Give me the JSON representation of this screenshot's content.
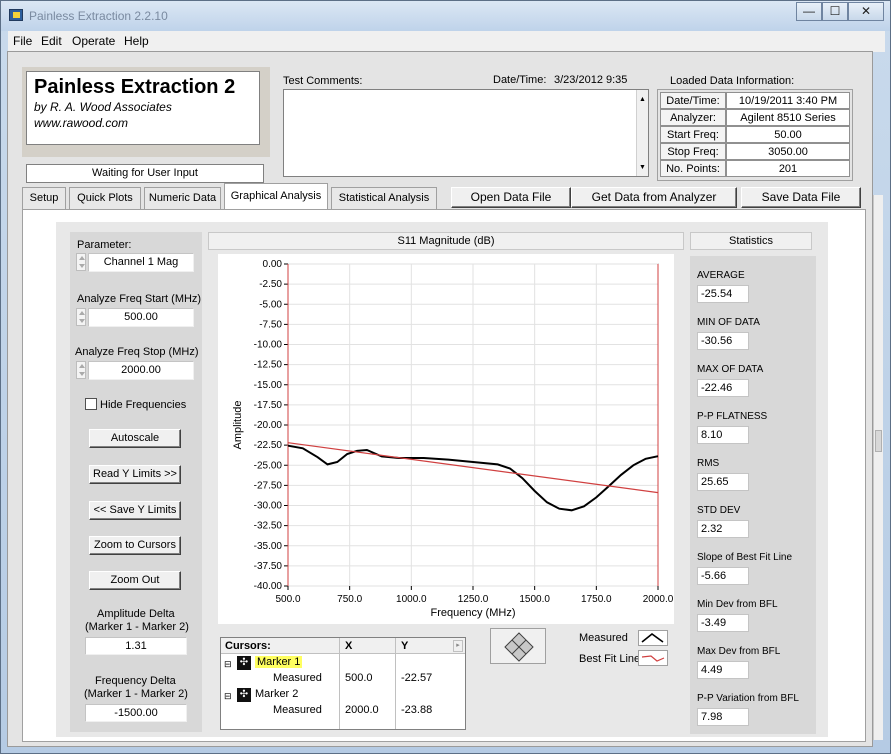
{
  "window": {
    "title": "Painless Extraction 2.2.10",
    "minimize": "—",
    "maximize": "☐",
    "close": "✕"
  },
  "menu": [
    "File",
    "Edit",
    "Operate",
    "Help"
  ],
  "brand": {
    "name": "Painless Extraction 2",
    "by": "by R. A. Wood Associates",
    "url": "www.rawood.com"
  },
  "status": "Waiting for User Input",
  "comments": {
    "label": "Test Comments:",
    "datetime_label": "Date/Time:",
    "datetime_value": "3/23/2012  9:35"
  },
  "loaded": {
    "title": "Loaded Data Information:",
    "rows": [
      {
        "k": "Date/Time:",
        "v": "10/19/2011 3:40 PM"
      },
      {
        "k": "Analyzer:",
        "v": "Agilent 8510 Series"
      },
      {
        "k": "Start Freq:",
        "v": "50.00"
      },
      {
        "k": "Stop Freq:",
        "v": "3050.00"
      },
      {
        "k": "No. Points:",
        "v": "201"
      }
    ]
  },
  "tabs": [
    "Setup",
    "Quick Plots",
    "Numeric Data",
    "Graphical Analysis",
    "Statistical Analysis"
  ],
  "active_tab": "Graphical Analysis",
  "actions": {
    "open": "Open Data File",
    "get": "Get Data from Analyzer",
    "save": "Save Data File"
  },
  "left": {
    "parameter_label": "Parameter:",
    "parameter_value": "Channel 1 Mag",
    "start_label": "Analyze Freq Start (MHz)",
    "start_value": "500.00",
    "stop_label": "Analyze Freq Stop (MHz)",
    "stop_value": "2000.00",
    "hide_freq": "Hide Frequencies",
    "autoscale": "Autoscale",
    "read_y": "Read Y Limits >>",
    "save_y": "<< Save Y Limits",
    "zoom_cursors": "Zoom to Cursors",
    "zoom_out": "Zoom Out",
    "amp_delta_label1": "Amplitude Delta",
    "amp_delta_label2": "(Marker 1 - Marker 2)",
    "amp_delta_value": "1.31",
    "freq_delta_label1": "Frequency Delta",
    "freq_delta_label2": "(Marker 1 - Marker 2)",
    "freq_delta_value": "-1500.00"
  },
  "chart_data": {
    "type": "line",
    "title": "S11 Magnitude (dB)",
    "xlabel": "Frequency (MHz)",
    "ylabel": "Amplitude",
    "xlim": [
      500,
      2000
    ],
    "ylim": [
      -40,
      0
    ],
    "grid": true,
    "x_ticks": [
      "500.0",
      "750.0",
      "1000.0",
      "1250.0",
      "1500.0",
      "1750.0",
      "2000.0"
    ],
    "y_ticks": [
      "0.00",
      "-2.50",
      "-5.00",
      "-7.50",
      "-10.00",
      "-12.50",
      "-15.00",
      "-17.50",
      "-20.00",
      "-22.50",
      "-25.00",
      "-27.50",
      "-30.00",
      "-32.50",
      "-35.00",
      "-37.50",
      "-40.00"
    ],
    "series": [
      {
        "name": "Measured",
        "color": "#000000",
        "x": [
          500,
          560,
          620,
          660,
          700,
          740,
          780,
          820,
          880,
          950,
          1050,
          1150,
          1250,
          1350,
          1400,
          1450,
          1500,
          1550,
          1600,
          1650,
          1700,
          1750,
          1800,
          1850,
          1900,
          1950,
          2000
        ],
        "y": [
          -22.57,
          -22.9,
          -24.0,
          -24.9,
          -24.6,
          -23.6,
          -23.2,
          -23.1,
          -23.9,
          -24.1,
          -24.1,
          -24.3,
          -24.6,
          -24.9,
          -25.4,
          -26.6,
          -28.2,
          -29.6,
          -30.4,
          -30.6,
          -30.1,
          -29.0,
          -27.6,
          -26.2,
          -25.0,
          -24.2,
          -23.88
        ]
      },
      {
        "name": "Best Fit Line",
        "color": "#d04040",
        "x": [
          500,
          2000
        ],
        "y": [
          -22.2,
          -28.4
        ]
      }
    ],
    "legend": [
      "Measured",
      "Best Fit Line"
    ]
  },
  "cursors": {
    "headers": [
      "Cursors:",
      "X",
      "Y"
    ],
    "rows": [
      {
        "name": "Marker 1",
        "measured": "Measured",
        "x": "500.0",
        "y": "-22.57"
      },
      {
        "name": "Marker 2",
        "measured": "Measured",
        "x": "2000.0",
        "y": "-23.88"
      }
    ]
  },
  "stats": {
    "title": "Statistics",
    "items": [
      {
        "label": "AVERAGE",
        "value": "-25.54"
      },
      {
        "label": "MIN OF DATA",
        "value": "-30.56"
      },
      {
        "label": "MAX OF DATA",
        "value": "-22.46"
      },
      {
        "label": "P-P FLATNESS",
        "value": "8.10"
      },
      {
        "label": "RMS",
        "value": "25.65"
      },
      {
        "label": "STD DEV",
        "value": "2.32"
      },
      {
        "label": "Slope of Best Fit Line",
        "value": "-5.66"
      },
      {
        "label": "Min Dev from BFL",
        "value": "-3.49"
      },
      {
        "label": "Max Dev from BFL",
        "value": "4.49"
      },
      {
        "label": "P-P Variation from BFL",
        "value": "7.98"
      }
    ]
  }
}
